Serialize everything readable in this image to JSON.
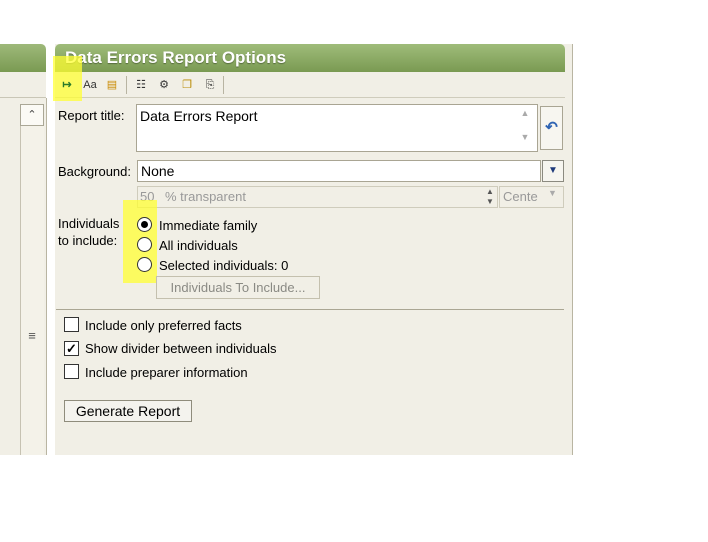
{
  "panel": {
    "title": "Data Errors Report Options"
  },
  "toolbar": {
    "items": [
      {
        "name": "report-options",
        "glyph": "↦"
      },
      {
        "name": "fonts",
        "glyph": "Aa"
      },
      {
        "name": "background",
        "glyph": "▤"
      },
      {
        "name": "layout",
        "glyph": "☷"
      },
      {
        "name": "tools",
        "glyph": "⚙"
      },
      {
        "name": "folder-open",
        "glyph": "❐"
      },
      {
        "name": "paste",
        "glyph": "⎘"
      }
    ]
  },
  "form": {
    "report_title_label": "Report title:",
    "report_title_value": "Data Errors Report",
    "background_label": "Background:",
    "background_value": "None",
    "transparency_value": "50",
    "transparency_unit": "% transparent",
    "alignment_value": "Cente",
    "individuals_label_line1": "Individuals",
    "individuals_label_line2": "to include:",
    "radio_options": [
      {
        "label": "Immediate family",
        "selected": true
      },
      {
        "label": "All individuals",
        "selected": false
      },
      {
        "label": "Selected individuals: 0",
        "selected": false
      }
    ],
    "individuals_button": "Individuals To Include...",
    "checkboxes": [
      {
        "label": "Include only preferred facts",
        "checked": false
      },
      {
        "label": "Show divider between individuals",
        "checked": true
      },
      {
        "label": "Include preparer information",
        "checked": false
      }
    ],
    "generate_button": "Generate Report"
  },
  "glyphs": {
    "scroll_up": "⌃",
    "scroll_grip": "≡",
    "undo": "↶",
    "dropdown": "▼",
    "spin_up": "▲",
    "spin_down": "▼",
    "check": "✓"
  },
  "colors": {
    "header_green": "#7a9a52",
    "panel_bg": "#f1efe6",
    "highlight": "#ffff33"
  }
}
